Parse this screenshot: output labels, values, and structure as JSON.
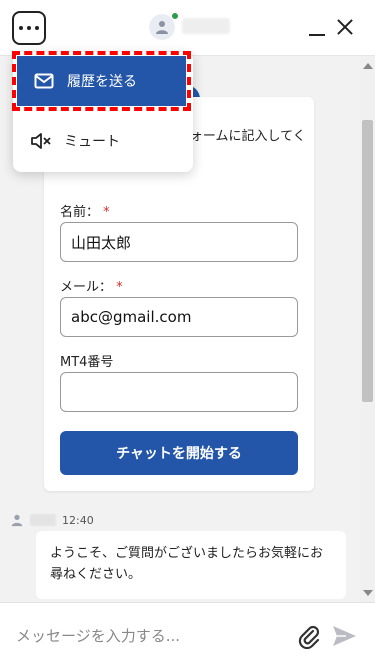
{
  "header": {
    "agent_online_color": "#2e9b49",
    "menu_icon": "more-horizontal-icon",
    "avatar_icon": "person-icon",
    "minimize_icon": "minimize-icon",
    "close_icon": "close-icon"
  },
  "menu": {
    "items": [
      {
        "label": "履歴を送る",
        "icon": "mail-icon",
        "highlighted": true
      },
      {
        "label": "ミュート",
        "icon": "speaker-mute-icon",
        "highlighted": false
      }
    ]
  },
  "form": {
    "intro": "ようこそ！チャットフォームに記入してください。",
    "name_label": "名前：",
    "name_required": "*",
    "name_value": "山田太郎",
    "email_label": "メール：",
    "email_required": "*",
    "email_value": "abc@gmail.com",
    "mt4_label": "MT4番号",
    "mt4_value": "",
    "start_button": "チャットを開始する"
  },
  "message": {
    "time": "12:40",
    "text": "ようこそ、ご質問がございましたらお気軽にお尋ねください。"
  },
  "composer": {
    "placeholder": "メッセージを入力する...",
    "attach_icon": "paperclip-icon",
    "send_icon": "send-icon"
  },
  "colors": {
    "accent": "#2356a8",
    "required": "#d32f2f",
    "focus_outline": "#ff0000"
  }
}
